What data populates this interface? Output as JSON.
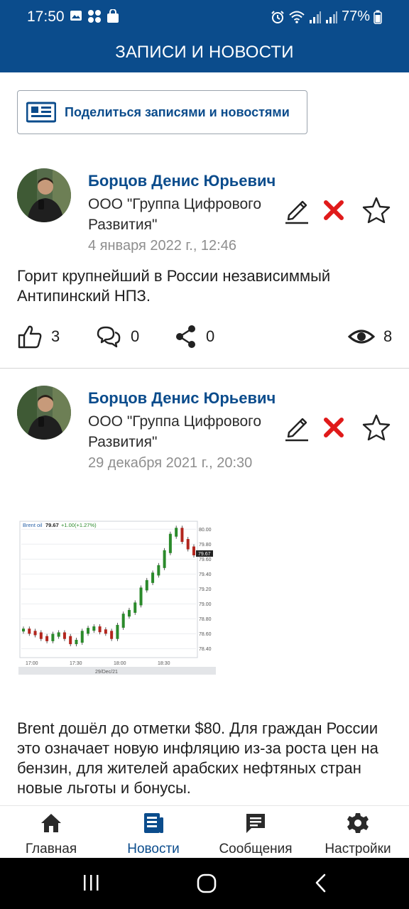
{
  "status_bar": {
    "time": "17:50",
    "battery": "77%"
  },
  "app_bar": {
    "title": "ЗАПИСИ И НОВОСТИ"
  },
  "share_button": {
    "label": "Поделиться записями и новостями"
  },
  "posts": [
    {
      "author": "Борцов Денис Юрьевич",
      "org": "ООО \"Группа Цифрового Развития\"",
      "date": "4 января 2022 г., 12:46",
      "text": "Горит крупнейший в России независиммый Антипинский НПЗ.",
      "likes": "3",
      "comments": "0",
      "shares": "0",
      "views": "8"
    },
    {
      "author": "Борцов Денис Юрьевич",
      "org": "ООО \"Группа Цифрового Развития\"",
      "date": "29 декабря 2021 г., 20:30",
      "text": "Brent дошёл до отметки $80. Для граждан России это означает новую инфляцию из-за роста цен на бензин, для жителей арабских нефтяных стран  новые льготы и бонусы."
    }
  ],
  "chart_data": {
    "type": "line",
    "title": "Brent oil",
    "last_value": "79.67",
    "change": "+1.00(+1.27%)",
    "date_label": "29/Dec/21",
    "x": [
      "17:00",
      "17:30",
      "18:00",
      "18:30"
    ],
    "ylim": [
      78.3,
      80.05
    ],
    "y_ticks": [
      "80.00",
      "79.80",
      "79.60",
      "79.40",
      "79.20",
      "79.00",
      "78.80",
      "78.60",
      "78.40"
    ],
    "series": [
      {
        "values": [
          78.65,
          78.62,
          78.6,
          78.55,
          78.52,
          78.58,
          78.6,
          78.55,
          78.48,
          78.5,
          78.62,
          78.66,
          78.68,
          78.64,
          78.62,
          78.55,
          78.7,
          78.85,
          78.9,
          79.0,
          79.2,
          79.3,
          79.4,
          79.5,
          79.7,
          79.92,
          80.0,
          79.85,
          79.75,
          79.67
        ]
      }
    ],
    "colors": {
      "up": "#2b8a2b",
      "down": "#b3261e",
      "change": "#2b8a2b"
    }
  },
  "bottom_nav": {
    "items": [
      {
        "label": "Главная",
        "icon": "home-icon"
      },
      {
        "label": "Новости",
        "icon": "news-icon"
      },
      {
        "label": "Сообщения",
        "icon": "messages-icon"
      },
      {
        "label": "Настройки",
        "icon": "settings-icon"
      }
    ],
    "active_index": 1
  },
  "colors": {
    "brand": "#0b4c8c",
    "delete": "#e01a1a"
  }
}
